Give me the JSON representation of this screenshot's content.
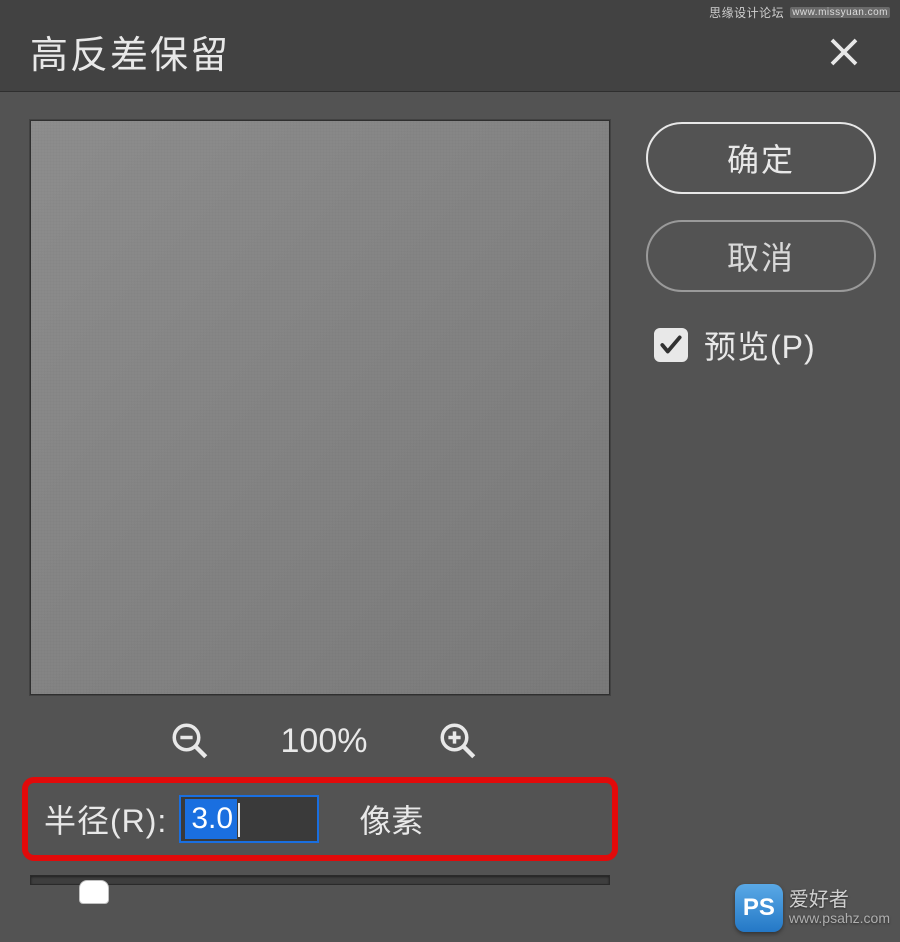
{
  "dialog": {
    "title": "高反差保留",
    "ok_label": "确定",
    "cancel_label": "取消",
    "preview_label": "预览(P)",
    "preview_checked": true
  },
  "zoom": {
    "level": "100%"
  },
  "radius": {
    "label": "半径(R):",
    "value": "3.0",
    "unit": "像素"
  },
  "watermark": {
    "top_text": "思缘设计论坛",
    "top_url": "www.missyuan.com",
    "logo_text": "PS",
    "bottom_cn": "爱好者",
    "bottom_url": "www.psahz.com"
  }
}
